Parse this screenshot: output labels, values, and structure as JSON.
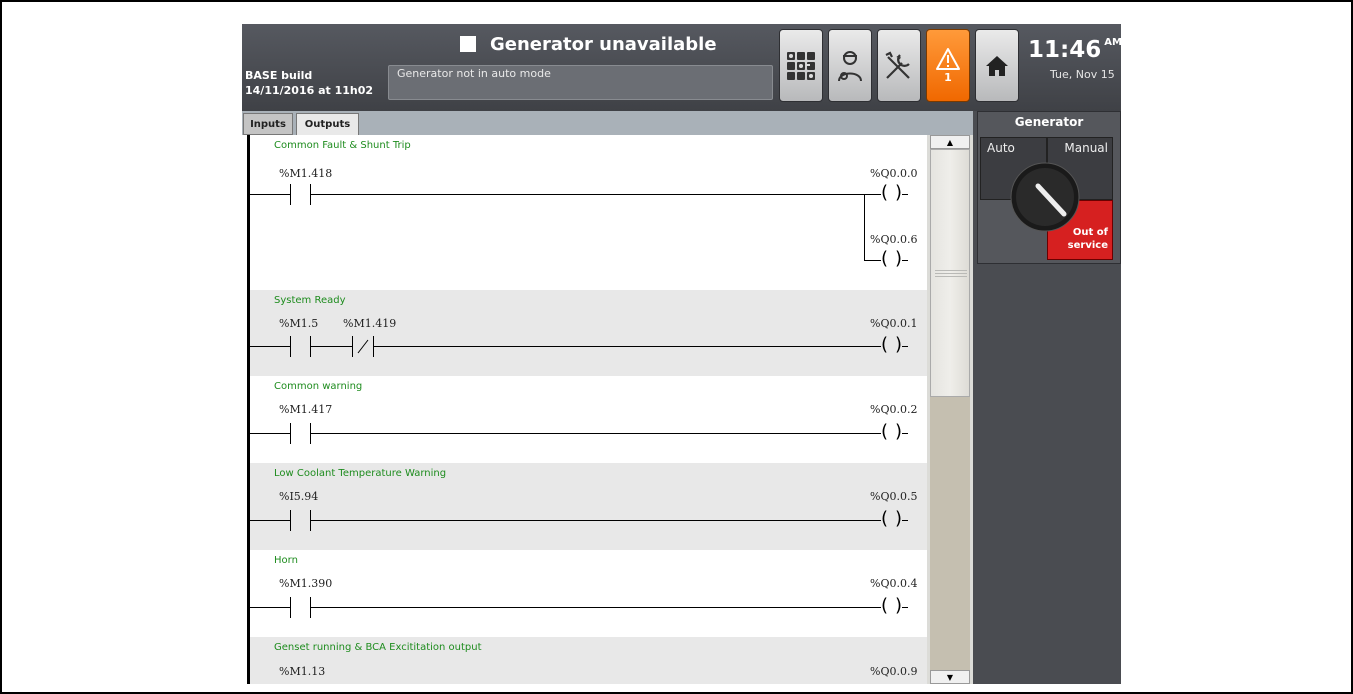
{
  "header": {
    "status_title": "Generator unavailable",
    "message": "Generator not in auto mode",
    "build_name": "BASE build",
    "build_date": "14/11/2016 at 11h02",
    "alarm_count": "1",
    "time": "11:46",
    "ampm": "AM",
    "date": "Tue, Nov 15",
    "icons": [
      "overview-grid-icon",
      "operator-icon",
      "tools-icon",
      "alarm-warning-icon",
      "home-icon"
    ]
  },
  "tabs": [
    {
      "label": "Inputs",
      "active": false
    },
    {
      "label": "Outputs",
      "active": true
    }
  ],
  "ladder": {
    "rungs": [
      {
        "title": "Common Fault & Shunt Trip",
        "contacts": [
          {
            "label": "%M1.418",
            "type": "NO"
          }
        ],
        "coils": [
          "%Q0.0.0",
          "%Q0.0.6"
        ]
      },
      {
        "title": "System Ready",
        "contacts": [
          {
            "label": "%M1.5",
            "type": "NO"
          },
          {
            "label": "%M1.419",
            "type": "NC"
          }
        ],
        "coils": [
          "%Q0.0.1"
        ]
      },
      {
        "title": "Common warning",
        "contacts": [
          {
            "label": "%M1.417",
            "type": "NO"
          }
        ],
        "coils": [
          "%Q0.0.2"
        ]
      },
      {
        "title": "Low Coolant Temperature Warning",
        "contacts": [
          {
            "label": "%I5.94",
            "type": "NO"
          }
        ],
        "coils": [
          "%Q0.0.5"
        ]
      },
      {
        "title": "Horn",
        "contacts": [
          {
            "label": "%M1.390",
            "type": "NO"
          }
        ],
        "coils": [
          "%Q0.0.4"
        ]
      },
      {
        "title": "Genset running & BCA Excititation output",
        "contacts": [
          {
            "label": "%M1.13",
            "type": "NO"
          }
        ],
        "coils": [
          "%Q0.0.9"
        ]
      }
    ]
  },
  "generator_panel": {
    "title": "Generator",
    "auto_label": "Auto",
    "manual_label": "Manual",
    "out_of_service_line1": "Out of",
    "out_of_service_line2": "service"
  },
  "colors": {
    "rung_title": "#1e8c1e",
    "alarm": "#f07a10",
    "out_of_service": "#d62020"
  }
}
